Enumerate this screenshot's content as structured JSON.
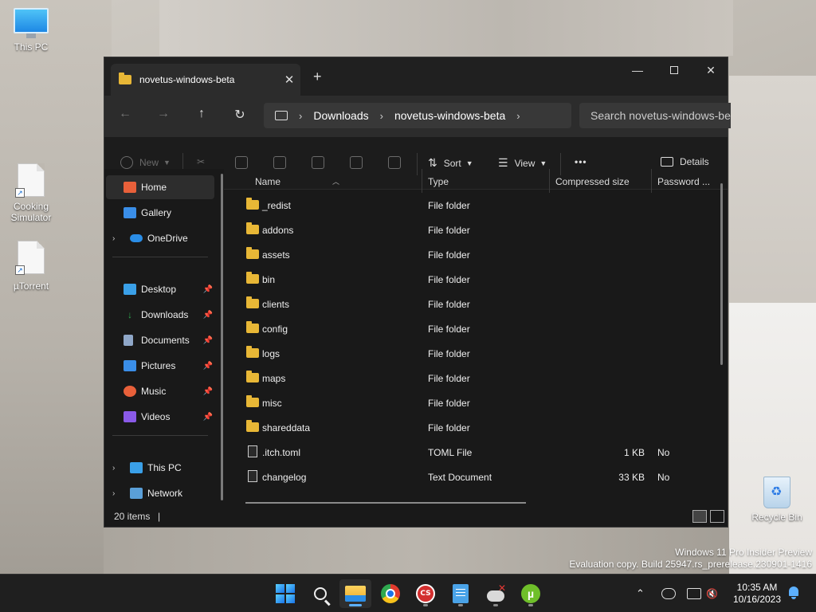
{
  "desktop": {
    "icons": [
      {
        "label": "This PC",
        "icon": "monitor-icon"
      },
      {
        "label": "Cooking\nSimulator",
        "icon": "file-shortcut-icon"
      },
      {
        "label": "µTorrent",
        "icon": "file-shortcut-icon"
      }
    ],
    "recycle_bin": {
      "label": "Recycle Bin",
      "icon": "recycle-bin-icon"
    },
    "watermark": {
      "line1": "Windows 11 Pro Insider Preview",
      "line2": "Evaluation copy. Build 25947.rs_prerelease.230901-1416"
    }
  },
  "explorer": {
    "tab": {
      "title": "novetus-windows-beta",
      "close": "✕",
      "new_tab": "+"
    },
    "window_controls": {
      "minimize": "—",
      "close": "✕"
    },
    "nav": {
      "back": "←",
      "forward": "→",
      "up": "↑",
      "refresh": "↻"
    },
    "address": {
      "separator": "›",
      "crumbs": [
        "Downloads",
        "novetus-windows-beta"
      ]
    },
    "search": {
      "placeholder": "Search novetus-windows-beta"
    },
    "commands": {
      "new": "New",
      "sort": "Sort",
      "view": "View",
      "more": "•••",
      "details": "Details"
    },
    "sidebar": {
      "home": "Home",
      "gallery": "Gallery",
      "onedrive": "OneDrive",
      "quick_access": [
        {
          "label": "Desktop",
          "color": "#3aa0e8"
        },
        {
          "label": "Downloads",
          "color": "#2fa84f"
        },
        {
          "label": "Documents",
          "color": "#8fa7c8"
        },
        {
          "label": "Pictures",
          "color": "#3a8ee8"
        },
        {
          "label": "Music",
          "color": "#e8603a"
        },
        {
          "label": "Videos",
          "color": "#8a5ae8"
        }
      ],
      "this_pc": "This PC",
      "network": "Network"
    },
    "columns": {
      "name": "Name",
      "type": "Type",
      "compressed_size": "Compressed size",
      "password": "Password ..."
    },
    "files": [
      {
        "name": "_redist",
        "type": "File folder",
        "size": "",
        "password": "",
        "kind": "folder"
      },
      {
        "name": "addons",
        "type": "File folder",
        "size": "",
        "password": "",
        "kind": "folder"
      },
      {
        "name": "assets",
        "type": "File folder",
        "size": "",
        "password": "",
        "kind": "folder"
      },
      {
        "name": "bin",
        "type": "File folder",
        "size": "",
        "password": "",
        "kind": "folder"
      },
      {
        "name": "clients",
        "type": "File folder",
        "size": "",
        "password": "",
        "kind": "folder"
      },
      {
        "name": "config",
        "type": "File folder",
        "size": "",
        "password": "",
        "kind": "folder"
      },
      {
        "name": "logs",
        "type": "File folder",
        "size": "",
        "password": "",
        "kind": "folder"
      },
      {
        "name": "maps",
        "type": "File folder",
        "size": "",
        "password": "",
        "kind": "folder"
      },
      {
        "name": "misc",
        "type": "File folder",
        "size": "",
        "password": "",
        "kind": "folder"
      },
      {
        "name": "shareddata",
        "type": "File folder",
        "size": "",
        "password": "",
        "kind": "folder"
      },
      {
        "name": ".itch.toml",
        "type": "TOML File",
        "size": "1 KB",
        "password": "No",
        "kind": "file"
      },
      {
        "name": "changelog",
        "type": "Text Document",
        "size": "33 KB",
        "password": "No",
        "kind": "text"
      }
    ],
    "status": {
      "count": "20 items",
      "cursor": "|"
    }
  },
  "taskbar": {
    "apps": [
      "start-icon",
      "search-icon",
      "file-explorer-icon",
      "chrome-icon",
      "cs-icon",
      "notepad-icon",
      "game-icon",
      "utorrent-icon"
    ],
    "utorrent_glyph": "µ",
    "cs_glyph": "CS",
    "tray_chevron": "⌃",
    "time": "10:35 AM",
    "date": "10/16/2023"
  }
}
